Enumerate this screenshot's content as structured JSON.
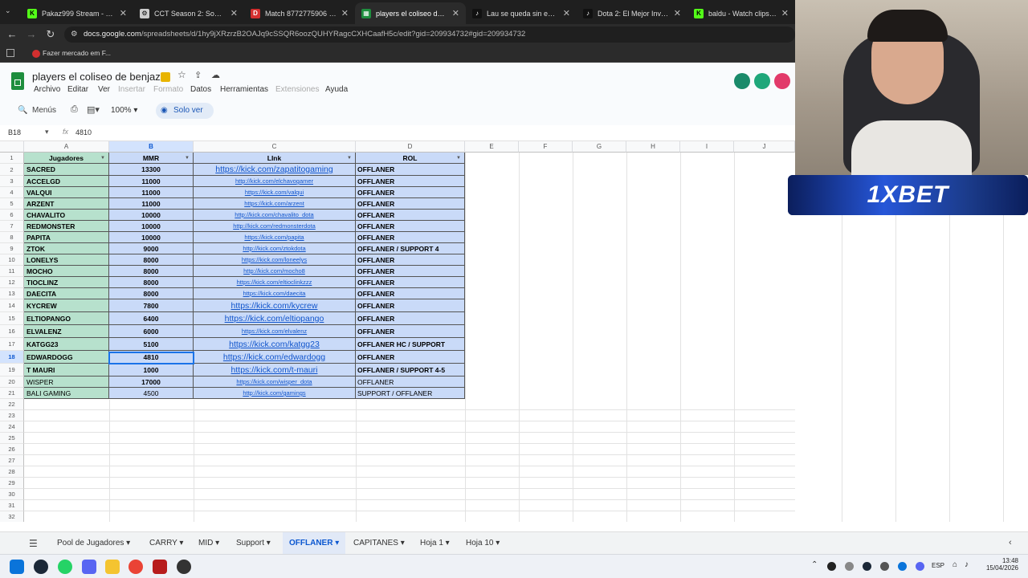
{
  "browser": {
    "tabs": [
      {
        "title": "Pakaz999 Stream - Watch",
        "fav_color": "#53fc18",
        "fav": "K"
      },
      {
        "title": "CCT Season 2: South Ame",
        "fav_color": "#cccccc",
        "fav": "⚙"
      },
      {
        "title": "Match 8772775906 - Ove",
        "fav_color": "#d32f2f",
        "fav": "D"
      },
      {
        "title": "players el coliseo de benj",
        "fav_color": "#1e8e3e",
        "fav": "▦"
      },
      {
        "title": "Lau se queda sin equipo!",
        "fav_color": "#111111",
        "fav": "♪"
      },
      {
        "title": "Dota 2: El Mejor Invoker d",
        "fav_color": "#111111",
        "fav": "♪"
      },
      {
        "title": "baldu - Watch clips on Ki",
        "fav_color": "#53fc18",
        "fav": "K"
      }
    ],
    "url_host": "docs.google.com",
    "url_path": "/spreadsheets/d/1hy9jXRzrzB2OAJq9cSSQR6oozQUHYRagcCXHCaafH5c/edit?gid=209934732#gid=209934732",
    "bookmark": "Fazer mercado em F..."
  },
  "sheets": {
    "title": "players el coliseo de benjaz",
    "menu": [
      "Archivo",
      "Editar",
      "Ver",
      "Insertar",
      "Formato",
      "Datos",
      "Herramientas",
      "Extensiones",
      "Ayuda"
    ],
    "search": "Menús",
    "zoom": "100%",
    "view_mode": "Solo ver",
    "cell_ref": "B18",
    "formula_value": "4810"
  },
  "grid": {
    "columns": [
      "A",
      "B",
      "C",
      "D",
      "E",
      "F",
      "G",
      "H",
      "I",
      "J"
    ],
    "headers": {
      "a": "Jugadores",
      "b": "MMR",
      "c": "LInk",
      "d": "ROL"
    },
    "rows": [
      {
        "player": "SACRED",
        "mmr": "13300",
        "link": "https://kick.com/zapatitogaming",
        "rol": "OFFLANER"
      },
      {
        "player": "ACCELGD",
        "mmr": "11000",
        "link": "http://kick.com/elchavogamer",
        "rol": "OFFLANER"
      },
      {
        "player": "VALQUI",
        "mmr": "11000",
        "link": "https://kick.com/valqui",
        "rol": "OFFLANER"
      },
      {
        "player": "ARZENT",
        "mmr": "11000",
        "link": "https://kick.com/arzent",
        "rol": "OFFLANER"
      },
      {
        "player": "CHAVALITO",
        "mmr": "10000",
        "link": "http://kick.com/chavalito_dota",
        "rol": "OFFLANER"
      },
      {
        "player": "REDMONSTER",
        "mmr": "10000",
        "link": "http://kick.com/redmonsterdota",
        "rol": "OFFLANER"
      },
      {
        "player": "PAPITA",
        "mmr": "10000",
        "link": "https://kick.com/papita",
        "rol": "OFFLANER"
      },
      {
        "player": "ZTOK",
        "mmr": "9000",
        "link": "http://kick.com/ztokdota",
        "rol": "OFFLANER / SUPPORT 4"
      },
      {
        "player": "LONELYS",
        "mmr": "8000",
        "link": "https://kick.com/loneelys",
        "rol": "OFFLANER"
      },
      {
        "player": "MOCHO",
        "mmr": "8000",
        "link": "http://kick.com/mocho8",
        "rol": "OFFLANER"
      },
      {
        "player": "TIOCLINZ",
        "mmr": "8000",
        "link": "https://kick.com/eltioclinkzzz",
        "rol": "OFFLANER"
      },
      {
        "player": "DAECITA",
        "mmr": "8000",
        "link": "https://kick.com/daecita",
        "rol": "OFFLANER"
      },
      {
        "player": "KYCREW",
        "mmr": "7800",
        "link": "https://kick.com/kycrew",
        "rol": "OFFLANER"
      },
      {
        "player": "ELTIOPANGO",
        "mmr": "6400",
        "link": "https://kick.com/eltiopango",
        "rol": "OFFLANER"
      },
      {
        "player": "ELVALENZ",
        "mmr": "6000",
        "link": "https://kick.com/elvalenz",
        "rol": "OFFLANER"
      },
      {
        "player": "KATGG23",
        "mmr": "5100",
        "link": "https://kick.com/katgg23",
        "rol": "OFFLANER HC / SUPPORT"
      },
      {
        "player": "EDWARDOGG",
        "mmr": "4810",
        "link": "https://kick.com/edwardogg",
        "rol": "OFFLANER"
      },
      {
        "player": "T MAURI",
        "mmr": "1000",
        "link": "https://kick.com/t-mauri",
        "rol": "OFFLANER / SUPPORT 4-5"
      },
      {
        "player": "WISPER",
        "mmr": "17000",
        "link": "https://kick.com/wisper_dota",
        "rol": "OFFLANER"
      },
      {
        "player": "BALI GAMING",
        "mmr": "4500",
        "link": "http://kick.com/gamings",
        "rol": "SUPPORT / OFFLANER"
      }
    ],
    "empty_rows": [
      "22",
      "23",
      "24",
      "25",
      "26",
      "27",
      "28",
      "29",
      "30",
      "31",
      "32"
    ]
  },
  "sheet_tabs": [
    "Pool de Jugadores",
    "CARRY",
    "MID",
    "Support",
    "OFFLANER",
    "CAPITANES",
    "Hoja 1",
    "Hoja 10"
  ],
  "active_sheet": "OFFLANER",
  "taskbar": {
    "lang": "ESP",
    "time": "13:48",
    "date": "15/04/2026"
  },
  "banner": {
    "text": "1XBET"
  }
}
